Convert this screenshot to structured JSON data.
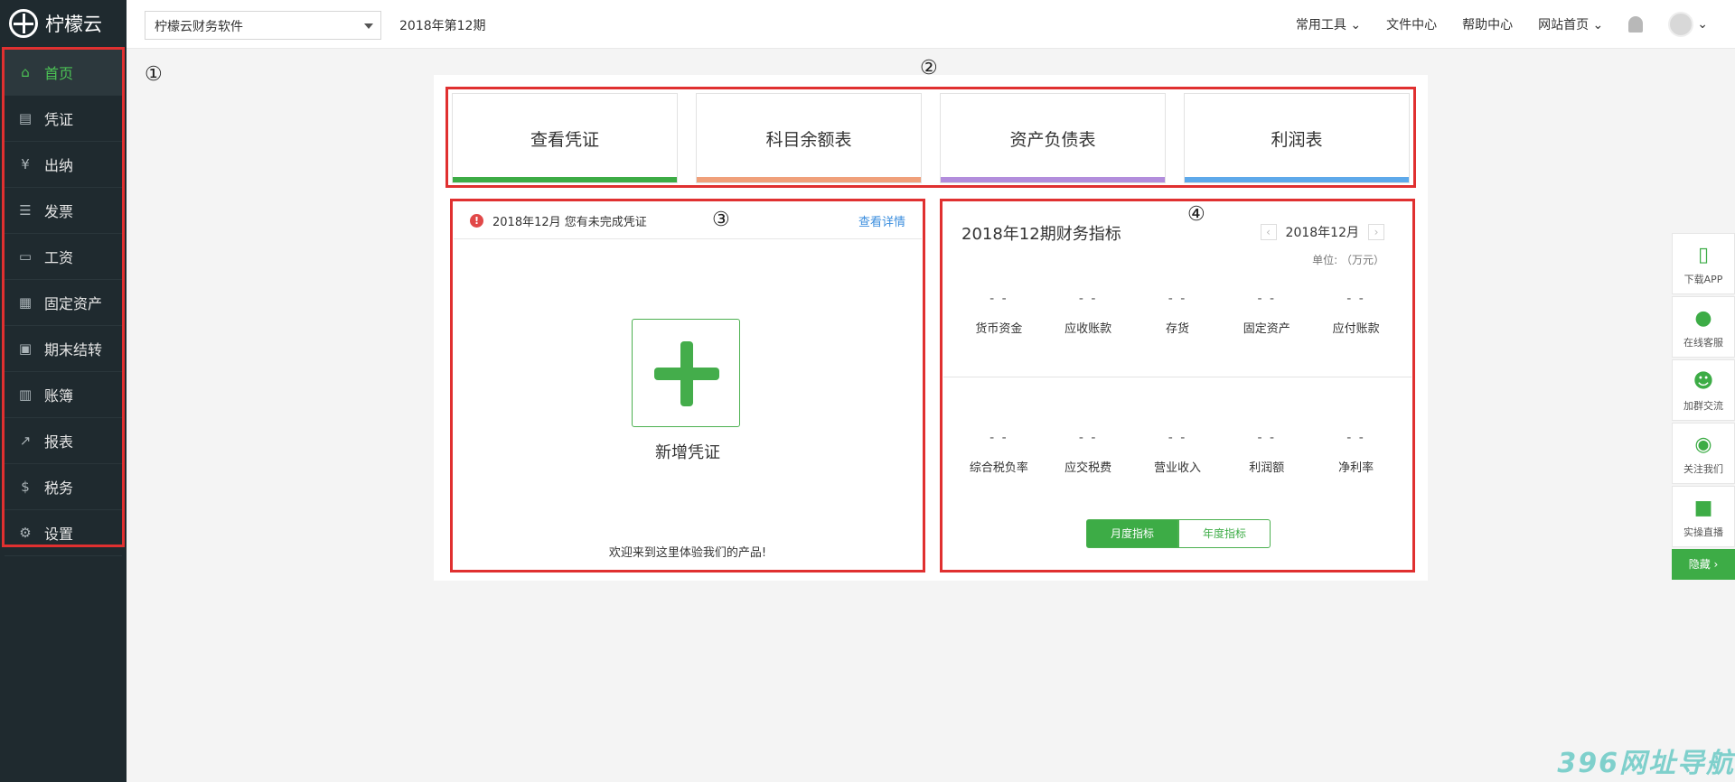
{
  "app": {
    "title": "柠檬云"
  },
  "sidebar": {
    "items": [
      {
        "label": "首页",
        "icon": "home-icon",
        "glyph": "⌂"
      },
      {
        "label": "凭证",
        "icon": "voucher-icon",
        "glyph": "▤"
      },
      {
        "label": "出纳",
        "icon": "cashier-icon",
        "glyph": "¥"
      },
      {
        "label": "发票",
        "icon": "invoice-icon",
        "glyph": "☰"
      },
      {
        "label": "工资",
        "icon": "salary-card-icon",
        "glyph": "▭"
      },
      {
        "label": "固定资产",
        "icon": "building-icon",
        "glyph": "▦"
      },
      {
        "label": "期末结转",
        "icon": "calendar-icon",
        "glyph": "▣"
      },
      {
        "label": "账簿",
        "icon": "ledger-icon",
        "glyph": "▥"
      },
      {
        "label": "报表",
        "icon": "chart-line-icon",
        "glyph": "↗"
      },
      {
        "label": "税务",
        "icon": "dollar-circle-icon",
        "glyph": "$"
      },
      {
        "label": "设置",
        "icon": "gear-icon",
        "glyph": "⚙"
      }
    ]
  },
  "topbar": {
    "company_select": "柠檬云财务软件",
    "period": "2018年第12期",
    "links": [
      "常用工具",
      "文件中心",
      "帮助中心",
      "网站首页"
    ]
  },
  "markers": {
    "m1": "①",
    "m2": "②",
    "m3": "③",
    "m4": "④"
  },
  "quick_cards": [
    {
      "label": "查看凭证",
      "color": "#3dac46"
    },
    {
      "label": "科目余额表",
      "color": "#f0a07a"
    },
    {
      "label": "资产负债表",
      "color": "#b28ddc"
    },
    {
      "label": "利润表",
      "color": "#5ea9ea"
    }
  ],
  "voucher_panel": {
    "alert_icon": "!",
    "alert_text": "2018年12月 您有未完成凭证",
    "detail_link": "查看详情",
    "add_label": "新增凭证",
    "welcome": "欢迎来到这里体验我们的产品!"
  },
  "finance_panel": {
    "title": "2018年12期财务指标",
    "month": "2018年12月",
    "prev": "‹",
    "next": "›",
    "unit": "单位: （万元）",
    "row1": [
      {
        "value": "- -",
        "label": "货币资金"
      },
      {
        "value": "- -",
        "label": "应收账款"
      },
      {
        "value": "- -",
        "label": "存货"
      },
      {
        "value": "- -",
        "label": "固定资产"
      },
      {
        "value": "- -",
        "label": "应付账款"
      }
    ],
    "row2": [
      {
        "value": "- -",
        "label": "综合税负率"
      },
      {
        "value": "- -",
        "label": "应交税费"
      },
      {
        "value": "- -",
        "label": "营业收入"
      },
      {
        "value": "- -",
        "label": "利润额"
      },
      {
        "value": "- -",
        "label": "净利率"
      }
    ],
    "tab_month": "月度指标",
    "tab_year": "年度指标"
  },
  "float_bar": {
    "items": [
      {
        "label": "下载APP",
        "icon": "phone-icon",
        "glyph": "▯"
      },
      {
        "label": "在线客服",
        "icon": "qq-icon",
        "glyph": "●"
      },
      {
        "label": "加群交流",
        "icon": "group-icon",
        "glyph": "☻"
      },
      {
        "label": "关注我们",
        "icon": "wechat-icon",
        "glyph": "◉"
      },
      {
        "label": "实操直播",
        "icon": "video-icon",
        "glyph": "■"
      }
    ],
    "hide": "隐藏 ›"
  },
  "watermark": "396网址导航"
}
